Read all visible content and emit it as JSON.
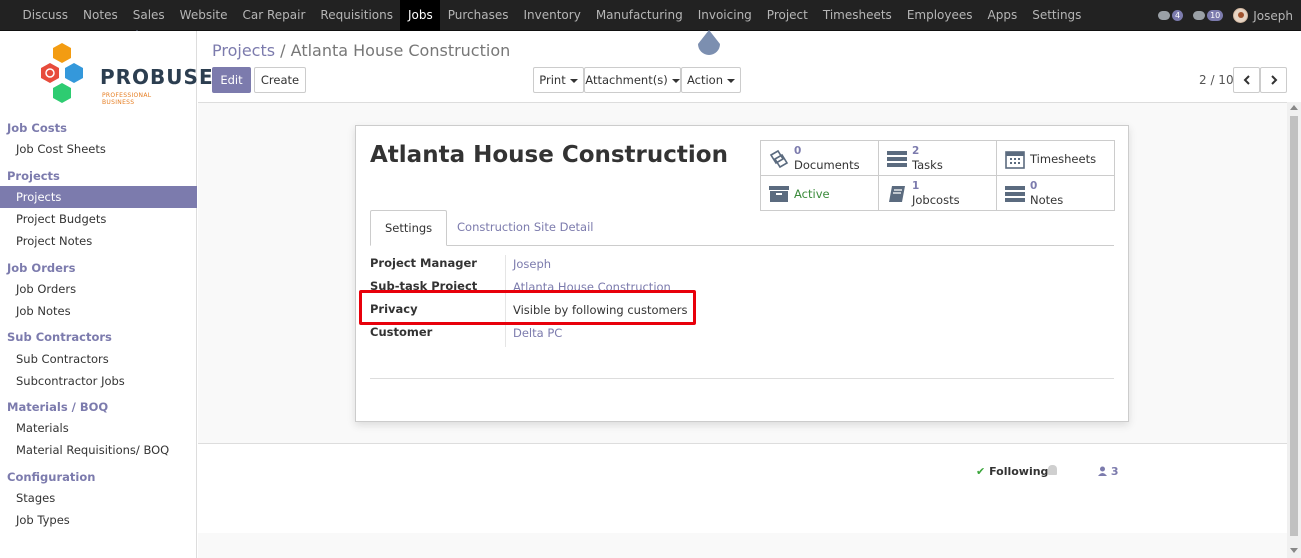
{
  "topnav": {
    "items": [
      "Discuss",
      "Notes",
      "Sales",
      "Website",
      "Car Repair",
      "Requisitions",
      "Jobs",
      "Purchases",
      "Inventory",
      "Manufacturing",
      "Invoicing",
      "Project",
      "Timesheets",
      "Employees",
      "Apps",
      "Settings"
    ],
    "active": "Jobs",
    "chat_count": "4",
    "activity_count": "10",
    "user": "Joseph"
  },
  "logo": {
    "text": "PROBUSE",
    "subtitle": "PROFESSIONAL BUSINESS"
  },
  "sidebar": {
    "sections": [
      {
        "title": "Job Costs",
        "items": [
          "Job Cost Sheets"
        ]
      },
      {
        "title": "Projects",
        "items": [
          "Projects",
          "Project Budgets",
          "Project Notes"
        ]
      },
      {
        "title": "Job Orders",
        "items": [
          "Job Orders",
          "Job Notes"
        ]
      },
      {
        "title": "Sub Contractors",
        "items": [
          "Sub Contractors",
          "Subcontractor Jobs"
        ]
      },
      {
        "title": "Materials / BOQ",
        "items": [
          "Materials",
          "Material Requisitions/ BOQ"
        ]
      },
      {
        "title": "Configuration",
        "items": [
          "Stages",
          "Job Types"
        ]
      }
    ],
    "active_item": "Projects"
  },
  "breadcrumb": {
    "parent": "Projects",
    "separator": "/",
    "current": "Atlanta House Construction"
  },
  "buttons": {
    "edit": "Edit",
    "create": "Create",
    "print": "Print",
    "attachments": "Attachment(s)",
    "action": "Action"
  },
  "pager": {
    "text": "2 / 10"
  },
  "record": {
    "title": "Atlanta House Construction",
    "stats": [
      {
        "count": "0",
        "label": "Documents",
        "icon": "documents-icon"
      },
      {
        "count": "2",
        "label": "Tasks",
        "icon": "tasks-icon"
      },
      {
        "count": "",
        "label": "Timesheets",
        "icon": "calendar-icon"
      },
      {
        "count": "",
        "label": "Active",
        "icon": "archive-icon"
      },
      {
        "count": "1",
        "label": "Jobcosts",
        "icon": "book-icon"
      },
      {
        "count": "0",
        "label": "Notes",
        "icon": "notes-icon"
      }
    ],
    "tabs": [
      "Settings",
      "Construction Site Detail"
    ],
    "fields": [
      {
        "label": "Project Manager",
        "value": "Joseph"
      },
      {
        "label": "Sub-task Project",
        "value": "Atlanta House Construction"
      },
      {
        "label": "Privacy",
        "value": "Visible by following customers"
      },
      {
        "label": "Customer",
        "value": "Delta PC"
      }
    ]
  },
  "chatter": {
    "following": "Following",
    "followers": "3"
  },
  "colors": {
    "accent": "#7c7bad",
    "navbar": "#222222",
    "highlight": "#e8000b",
    "active_green": "#3a8a3a"
  }
}
